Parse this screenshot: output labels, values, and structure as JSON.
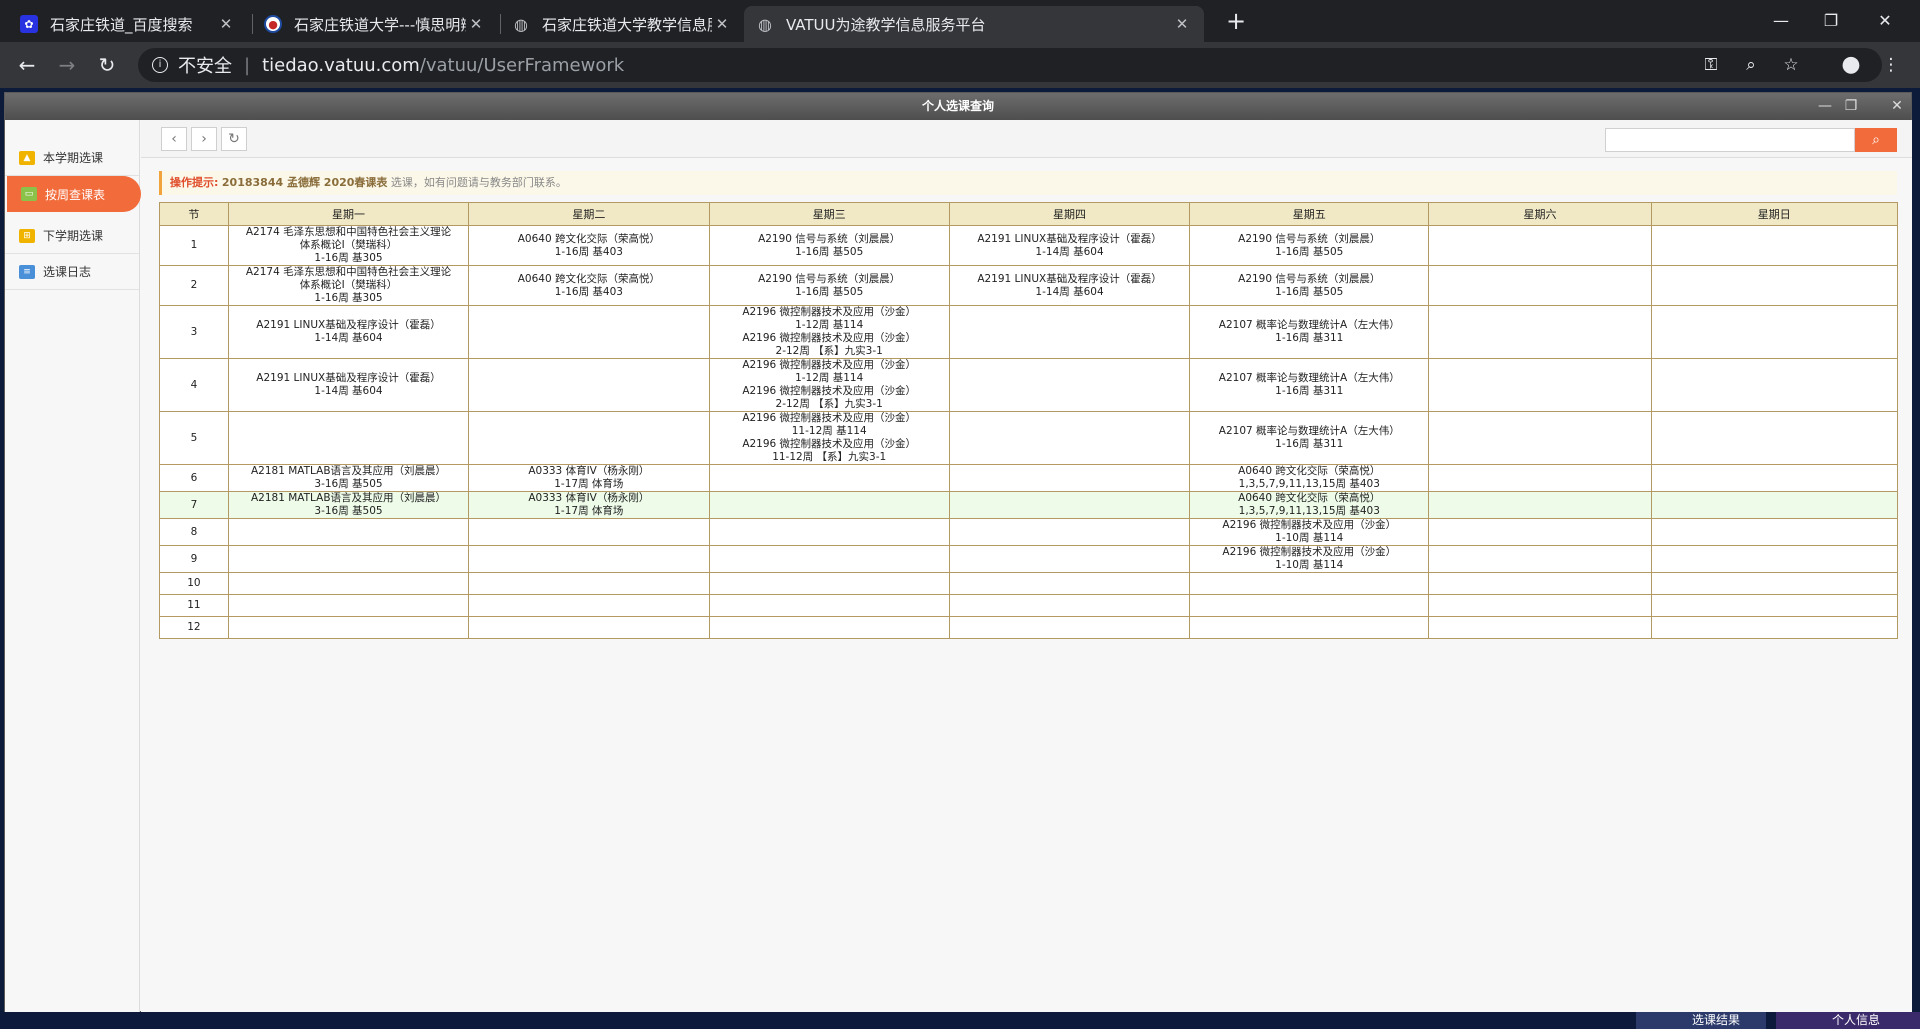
{
  "browser": {
    "tabs": [
      {
        "title": "石家庄铁道_百度搜索",
        "icon": "baidu-paw-icon"
      },
      {
        "title": "石家庄铁道大学---慎思明辨、知",
        "icon": "university-logo-icon"
      },
      {
        "title": "石家庄铁道大学教学信息服务网-",
        "icon": "globe-icon"
      },
      {
        "title": "VATUU为途教学信息服务平台",
        "icon": "globe-icon"
      }
    ],
    "new_tab": "+",
    "url_security": "不安全",
    "url_host": "tiedao.vatuu.com",
    "url_path": "/vatuu/UserFramework"
  },
  "window": {
    "title": "个人选课查询"
  },
  "sidebar": {
    "items": [
      {
        "label": "本学期选课",
        "icon": "course-select-icon",
        "color": "#f0b400"
      },
      {
        "label": "按周查课表",
        "icon": "monitor-icon",
        "color": "#8bc34a"
      },
      {
        "label": "下学期选课",
        "icon": "cart-icon",
        "color": "#f0b400"
      },
      {
        "label": "选课日志",
        "icon": "log-icon",
        "color": "#4a90d9"
      }
    ]
  },
  "toolbar": {
    "search_placeholder": ""
  },
  "tip": {
    "label": "操作提示:",
    "student": "20183844 孟德辉 2020春课表",
    "message": "选课，如有问题请与教务部门联系。"
  },
  "schedule": {
    "headers": [
      "节",
      "星期一",
      "星期二",
      "星期三",
      "星期四",
      "星期五",
      "星期六",
      "星期日"
    ],
    "rows": [
      {
        "period": "1",
        "cells": [
          [
            "A2174 毛泽东思想和中国特色社会主义理论",
            "体系概论I（樊瑞科）",
            "1-16周 基305"
          ],
          [
            "A0640 跨文化交际（荣高悦）",
            "1-16周 基403"
          ],
          [
            "A2190 信号与系统（刘晨晨）",
            "1-16周 基505"
          ],
          [
            "A2191 LINUX基础及程序设计（霍磊）",
            "1-14周 基604"
          ],
          [
            "A2190 信号与系统（刘晨晨）",
            "1-16周 基505"
          ],
          [],
          []
        ]
      },
      {
        "period": "2",
        "cells": [
          [
            "A2174 毛泽东思想和中国特色社会主义理论",
            "体系概论I（樊瑞科）",
            "1-16周 基305"
          ],
          [
            "A0640 跨文化交际（荣高悦）",
            "1-16周 基403"
          ],
          [
            "A2190 信号与系统（刘晨晨）",
            "1-16周 基505"
          ],
          [
            "A2191 LINUX基础及程序设计（霍磊）",
            "1-14周 基604"
          ],
          [
            "A2190 信号与系统（刘晨晨）",
            "1-16周 基505"
          ],
          [],
          []
        ]
      },
      {
        "period": "3",
        "cells": [
          [
            "A2191 LINUX基础及程序设计（霍磊）",
            "1-14周 基604"
          ],
          [],
          [
            "A2196 微控制器技术及应用（沙金）",
            "1-12周 基114",
            "A2196 微控制器技术及应用（沙金）",
            "2-12周 【系】九实3-1"
          ],
          [],
          [
            "A2107 概率论与数理统计A（左大伟）",
            "1-16周 基311"
          ],
          [],
          []
        ]
      },
      {
        "period": "4",
        "cells": [
          [
            "A2191 LINUX基础及程序设计（霍磊）",
            "1-14周 基604"
          ],
          [],
          [
            "A2196 微控制器技术及应用（沙金）",
            "1-12周 基114",
            "A2196 微控制器技术及应用（沙金）",
            "2-12周 【系】九实3-1"
          ],
          [],
          [
            "A2107 概率论与数理统计A（左大伟）",
            "1-16周 基311"
          ],
          [],
          []
        ]
      },
      {
        "period": "5",
        "cells": [
          [],
          [],
          [
            "A2196 微控制器技术及应用（沙金）",
            "11-12周 基114",
            "A2196 微控制器技术及应用（沙金）",
            "11-12周 【系】九实3-1"
          ],
          [],
          [
            "A2107 概率论与数理统计A（左大伟）",
            "1-16周 基311"
          ],
          [],
          []
        ]
      },
      {
        "period": "6",
        "cells": [
          [
            "A2181 MATLAB语言及其应用（刘晨晨）",
            "3-16周 基505"
          ],
          [
            "A0333 体育IV（杨永刚）",
            "1-17周 体育场"
          ],
          [],
          [],
          [
            "A0640 跨文化交际（荣高悦）",
            "1,3,5,7,9,11,13,15周 基403"
          ],
          [],
          []
        ]
      },
      {
        "period": "7",
        "cells": [
          [
            "A2181 MATLAB语言及其应用（刘晨晨）",
            "3-16周 基505"
          ],
          [
            "A0333 体育IV（杨永刚）",
            "1-17周 体育场"
          ],
          [],
          [],
          [
            "A0640 跨文化交际（荣高悦）",
            "1,3,5,7,9,11,13,15周 基403"
          ],
          [],
          []
        ]
      },
      {
        "period": "8",
        "cells": [
          [],
          [],
          [],
          [],
          [
            "A2196 微控制器技术及应用（沙金）",
            "1-10周 基114"
          ],
          [],
          []
        ]
      },
      {
        "period": "9",
        "cells": [
          [],
          [],
          [],
          [],
          [
            "A2196 微控制器技术及应用（沙金）",
            "1-10周 基114"
          ],
          [],
          []
        ]
      },
      {
        "period": "10",
        "cells": [
          [],
          [],
          [],
          [],
          [],
          [],
          []
        ]
      },
      {
        "period": "11",
        "cells": [
          [],
          [],
          [],
          [],
          [],
          [],
          []
        ]
      },
      {
        "period": "12",
        "cells": [
          [],
          [],
          [],
          [],
          [],
          [],
          []
        ]
      }
    ]
  },
  "taskbar": {
    "items": [
      {
        "label": "选课结果"
      },
      {
        "label": "个人信息"
      }
    ]
  },
  "colors": {
    "accent": "#f26b3a",
    "table_header": "#f1e9c6",
    "table_border": "#b39a62",
    "highlight_row": "#eefbe9"
  }
}
